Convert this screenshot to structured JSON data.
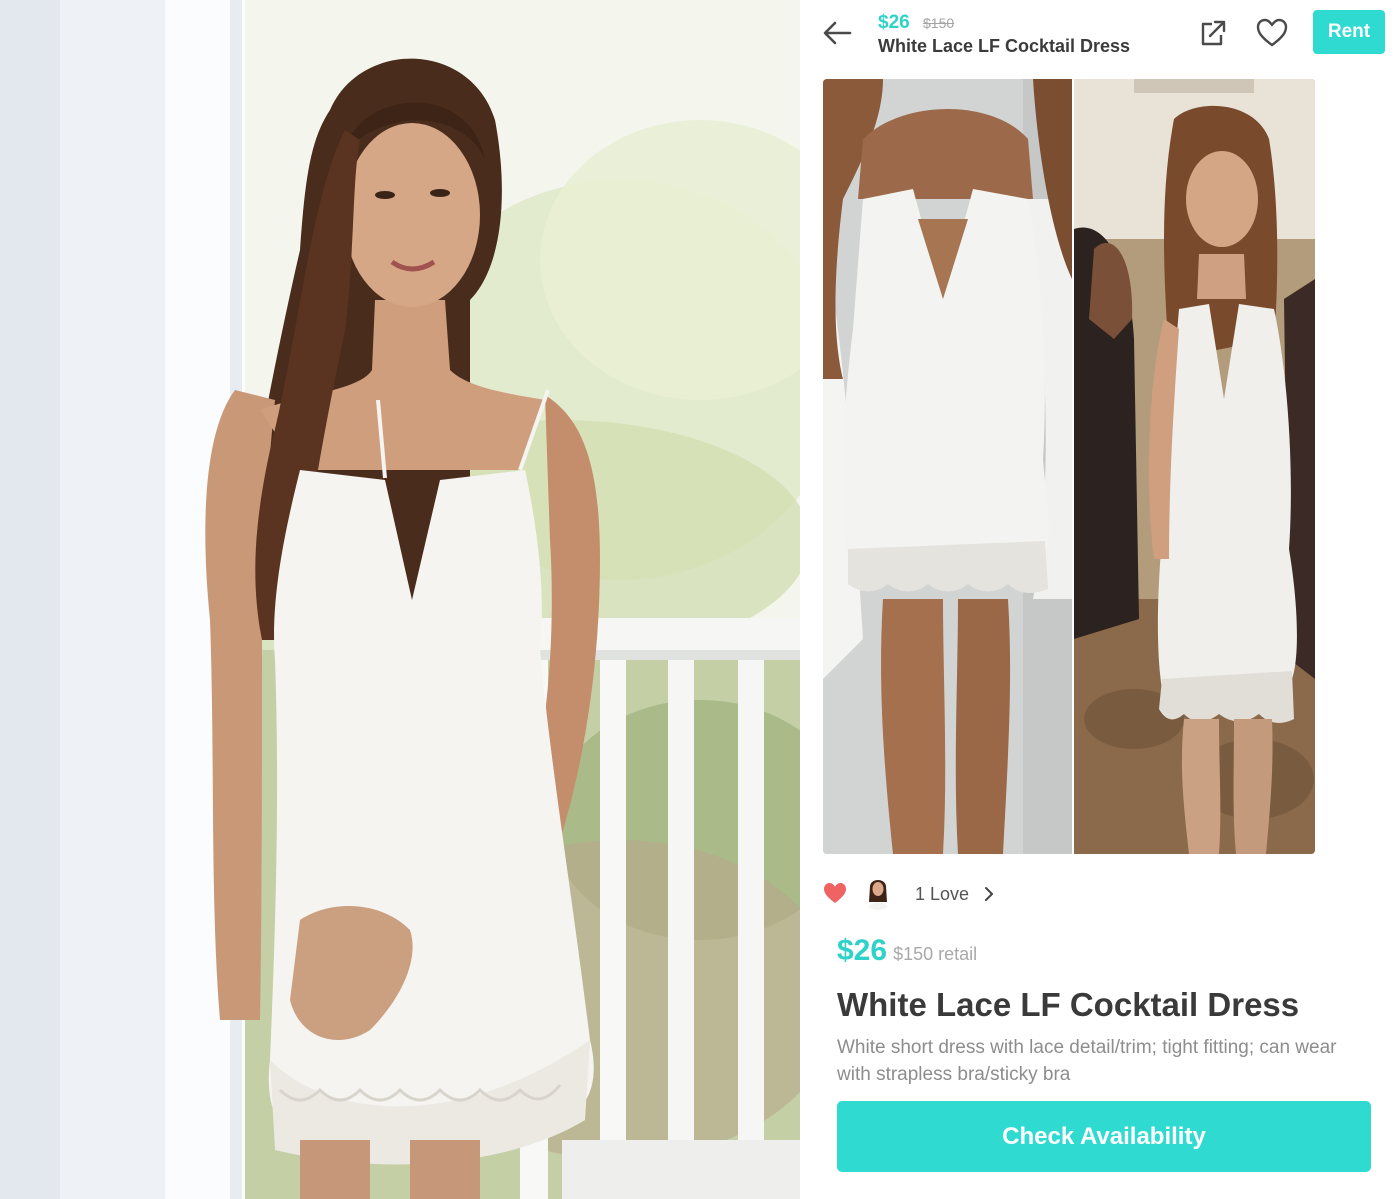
{
  "header": {
    "price": "$26",
    "retail_price": "$150",
    "title": "White Lace LF Cocktail Dress",
    "rent_label": "Rent",
    "icons": {
      "back": "back-arrow-icon",
      "share": "share-external-icon",
      "favorite": "heart-outline-icon"
    }
  },
  "gallery": {
    "photos": [
      "dress-front-view-photo",
      "dress-worn-event-photo"
    ]
  },
  "loves": {
    "count_label": "1 Love",
    "icons": {
      "heart": "heart-filled-icon",
      "chevron": "chevron-right-icon"
    }
  },
  "product": {
    "price": "$26",
    "retail_label": "$150 retail",
    "title": "White Lace LF Cocktail Dress",
    "description": "White short dress with lace detail/trim; tight fitting; can wear with strapless bra/sticky bra"
  },
  "cta": {
    "label": "Check Availability"
  },
  "colors": {
    "accent": "#2fdbd1",
    "price_text": "#2ed2c8",
    "love_heart": "#f06363",
    "title_text": "#3a3a3a",
    "muted_text": "#8d8d8d"
  }
}
